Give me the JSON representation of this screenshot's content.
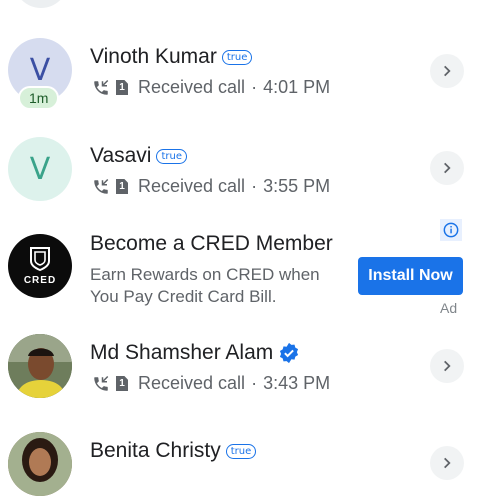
{
  "calls": [
    {
      "name": "Vinoth Kumar",
      "badge": "true",
      "initial": "V",
      "timer": "1m",
      "call_type": "Received call",
      "time": "4:01 PM"
    },
    {
      "name": "Vasavi",
      "badge": "true",
      "initial": "V",
      "call_type": "Received call",
      "time": "3:55 PM"
    },
    {
      "name": "Md Shamsher Alam",
      "call_type": "Received call",
      "time": "3:43 PM"
    },
    {
      "name": "Benita Christy",
      "badge": "true"
    }
  ],
  "ad": {
    "logo_text": "CRED",
    "title": "Become a CRED Member",
    "body_line1": "Earn Rewards on CRED when",
    "body_line2": "You Pay Credit Card Bill.",
    "cta": "Install Now",
    "ad_label": "Ad"
  },
  "sim_slot": "1",
  "separator": "·",
  "colors": {
    "accent": "#1a73e8",
    "avatar1_bg": "#d6dcef",
    "avatar1_fg": "#3b4fa3",
    "avatar2_bg": "#ddf2ec",
    "avatar2_fg": "#3aa38a"
  }
}
